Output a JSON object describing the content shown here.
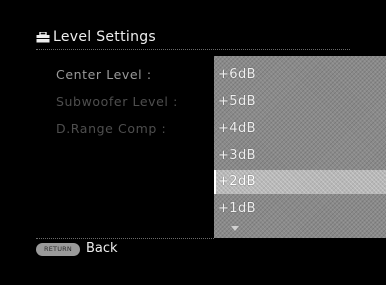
{
  "header": {
    "title": "Level Settings",
    "icon": "toolbox-icon"
  },
  "settings": [
    {
      "label": "Center Level :"
    },
    {
      "label": "Subwoofer Level :"
    },
    {
      "label": "D.Range Comp :"
    }
  ],
  "dropdown": {
    "options": [
      "+6dB",
      "+5dB",
      "+4dB",
      "+3dB",
      "+2dB",
      "+1dB"
    ],
    "selected": "+2dB",
    "more_below_icon": "triangle-down-icon"
  },
  "footer": {
    "return_button_label": "RETURN",
    "back_label": "Back"
  },
  "colors": {
    "background": "#000000",
    "dropdown": "#8a8a8a",
    "selected": "#b8b8b8"
  }
}
